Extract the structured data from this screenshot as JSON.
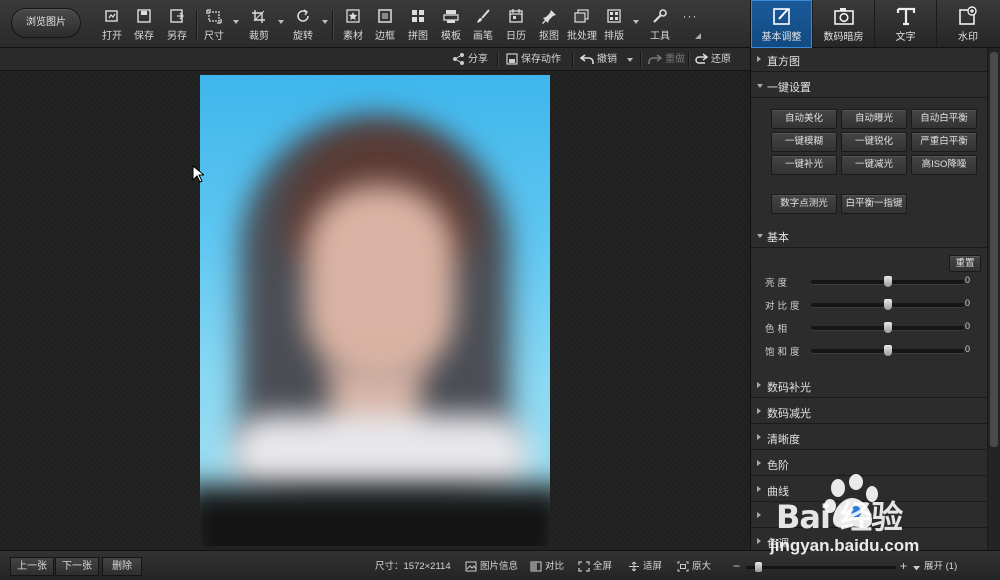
{
  "toolbar": {
    "browse_label": "浏览图片",
    "tools": [
      {
        "label": "打开",
        "icon": "open-icon"
      },
      {
        "label": "保存",
        "icon": "save-icon"
      },
      {
        "label": "另存",
        "icon": "save-as-icon"
      },
      {
        "label": "尺寸",
        "icon": "resize-icon"
      },
      {
        "label": "裁剪",
        "icon": "crop-icon"
      },
      {
        "label": "旋转",
        "icon": "rotate-icon"
      },
      {
        "label": "素材",
        "icon": "material-icon"
      },
      {
        "label": "边框",
        "icon": "border-icon"
      },
      {
        "label": "拼图",
        "icon": "collage-icon"
      },
      {
        "label": "模板",
        "icon": "template-icon"
      },
      {
        "label": "画笔",
        "icon": "brush-icon"
      },
      {
        "label": "日历",
        "icon": "calendar-icon"
      },
      {
        "label": "抠图",
        "icon": "cutout-icon"
      },
      {
        "label": "批处理",
        "icon": "batch-icon"
      },
      {
        "label": "排版",
        "icon": "layout-icon"
      },
      {
        "label": "工具",
        "icon": "wrench-icon"
      }
    ],
    "more_label": "···"
  },
  "right_tabs": [
    {
      "label": "基本调整",
      "icon": "adjust-icon",
      "active": true
    },
    {
      "label": "数码暗房",
      "icon": "camera-icon",
      "active": false
    },
    {
      "label": "文字",
      "icon": "text-icon",
      "active": false
    },
    {
      "label": "水印",
      "icon": "watermark-icon",
      "active": false
    }
  ],
  "actions": {
    "share": "分享",
    "save_action": "保存动作",
    "undo": "撤销",
    "redo": "重做",
    "restore": "还原"
  },
  "panel": {
    "histogram": "直方图",
    "one_click": "一键设置",
    "one_click_buttons": [
      "自动美化",
      "自动曝光",
      "自动白平衡",
      "一键模糊",
      "一键锐化",
      "严重白平衡",
      "一键补光",
      "一键减光",
      "高ISO降噪"
    ],
    "extra_buttons": [
      "数字点测光",
      "白平衡一指键"
    ],
    "basic": "基本",
    "reset": "重置",
    "sliders": [
      {
        "name": "亮度",
        "value": "0",
        "position": 0.5
      },
      {
        "name": "对比度",
        "value": "0",
        "position": 0.5
      },
      {
        "name": "色相",
        "value": "0",
        "position": 0.5
      },
      {
        "name": "饱和度",
        "value": "0",
        "position": 0.5
      }
    ],
    "collapsed_sections": [
      "数码补光",
      "数码减光",
      "清晰度",
      "色阶",
      "曲线",
      "",
      "色调"
    ]
  },
  "status": {
    "prev": "上一张",
    "next": "下一张",
    "delete": "删除",
    "size": "尺寸：1572×2114",
    "info": "图片信息",
    "compare": "对比",
    "fullscreen": "全屏",
    "fit": "适屏",
    "original": "原大",
    "zoom_minus": "−",
    "zoom_plus": "+",
    "zoom_level": 0.08,
    "expand": "展开 (1)"
  },
  "watermark": {
    "brand": "Bai 经验",
    "url": "jingyan.baidu.com"
  },
  "colors": {
    "accent": "#1a5a9a",
    "panel": "#2c2c2c",
    "sky": "#3fb6ec"
  }
}
